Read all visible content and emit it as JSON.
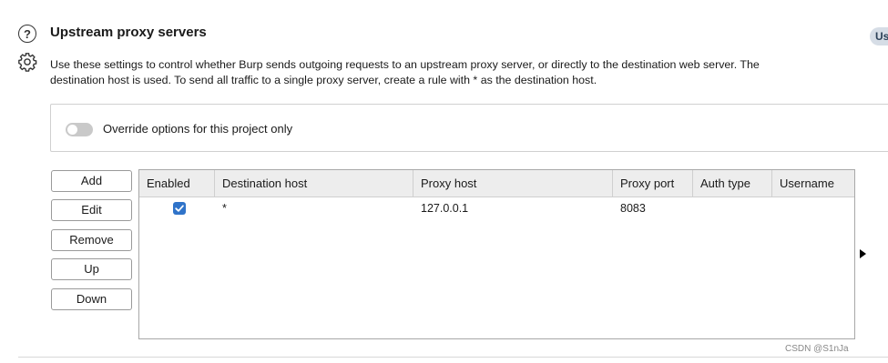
{
  "section": {
    "title": "Upstream proxy servers",
    "use_pill": "Us",
    "description_line1": "Use these settings to control whether Burp sends outgoing requests to an upstream proxy server, or directly to the destination web server. The",
    "description_line2": "destination host is used. To send all traffic to a single proxy server, create a rule with * as the destination host."
  },
  "override": {
    "label": "Override options for this project only",
    "enabled": false
  },
  "buttons": {
    "add": "Add",
    "edit": "Edit",
    "remove": "Remove",
    "up": "Up",
    "down": "Down"
  },
  "table": {
    "columns": [
      "Enabled",
      "Destination host",
      "Proxy host",
      "Proxy port",
      "Auth type",
      "Username"
    ],
    "rows": [
      {
        "enabled": true,
        "destination_host": "*",
        "proxy_host": "127.0.0.1",
        "proxy_port": "8083",
        "auth_type": "",
        "username": ""
      }
    ]
  },
  "watermark": "CSDN @S1nJa",
  "colors": {
    "accent": "#2f73c9",
    "pill_bg": "#d6dde6",
    "header_bg": "#ededed"
  }
}
